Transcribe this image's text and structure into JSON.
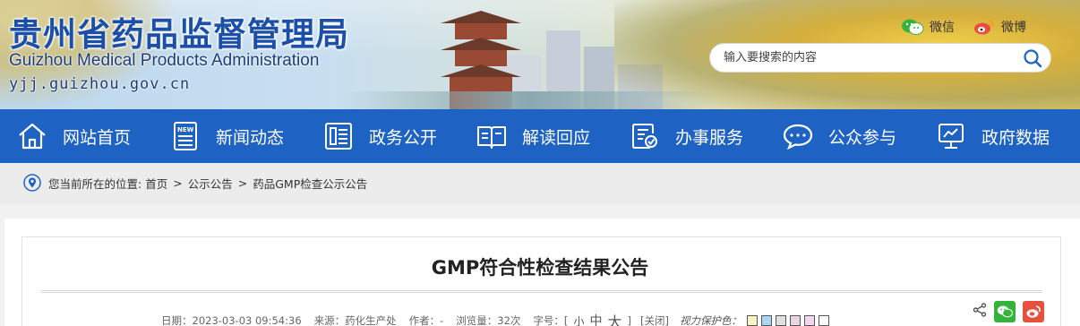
{
  "header": {
    "title": "贵州省药品监督管理局",
    "subtitle": "Guizhou Medical Products Administration",
    "domain": "yjj.guizhou.gov.cn",
    "social": [
      {
        "label": "微信",
        "icon": "wechat-icon"
      },
      {
        "label": "微博",
        "icon": "weibo-icon"
      }
    ],
    "search": {
      "placeholder": "输入要搜索的内容",
      "value": ""
    }
  },
  "nav": {
    "items": [
      {
        "label": "网站首页",
        "icon": "home-icon"
      },
      {
        "label": "新闻动态",
        "icon": "news-icon"
      },
      {
        "label": "政务公开",
        "icon": "document-icon"
      },
      {
        "label": "解读回应",
        "icon": "book-icon"
      },
      {
        "label": "办事服务",
        "icon": "service-icon"
      },
      {
        "label": "公众参与",
        "icon": "chat-icon"
      },
      {
        "label": "政府数据",
        "icon": "data-icon"
      }
    ]
  },
  "breadcrumb": {
    "prefix": "您当前所在的位置:",
    "items": [
      "首页",
      "公示公告",
      "药品GMP检查公示公告"
    ],
    "separator": ">"
  },
  "article": {
    "title": "GMP符合性检查结果公告",
    "meta": {
      "date": "日期：2023-03-03 09:54:36",
      "source": "来源：药化生产处",
      "author": "作者：-",
      "views": "浏览量：32次",
      "font_size_label": "字号：[",
      "font_size_options": [
        "小",
        "中",
        "大"
      ],
      "font_size_end": "]",
      "close": "[关闭]",
      "eye_label": "视力保护色：",
      "eye_colors": [
        "#f9f4c2",
        "#a9d6f2",
        "#e0e0e0",
        "#e9d4df",
        "#f1d6f0",
        "#ffffff"
      ]
    }
  },
  "colors": {
    "nav_bg": "#1e62c4",
    "title_blue": "#1b4fa8",
    "wechat_green": "#33b33a",
    "weibo_red": "#e8503e"
  }
}
